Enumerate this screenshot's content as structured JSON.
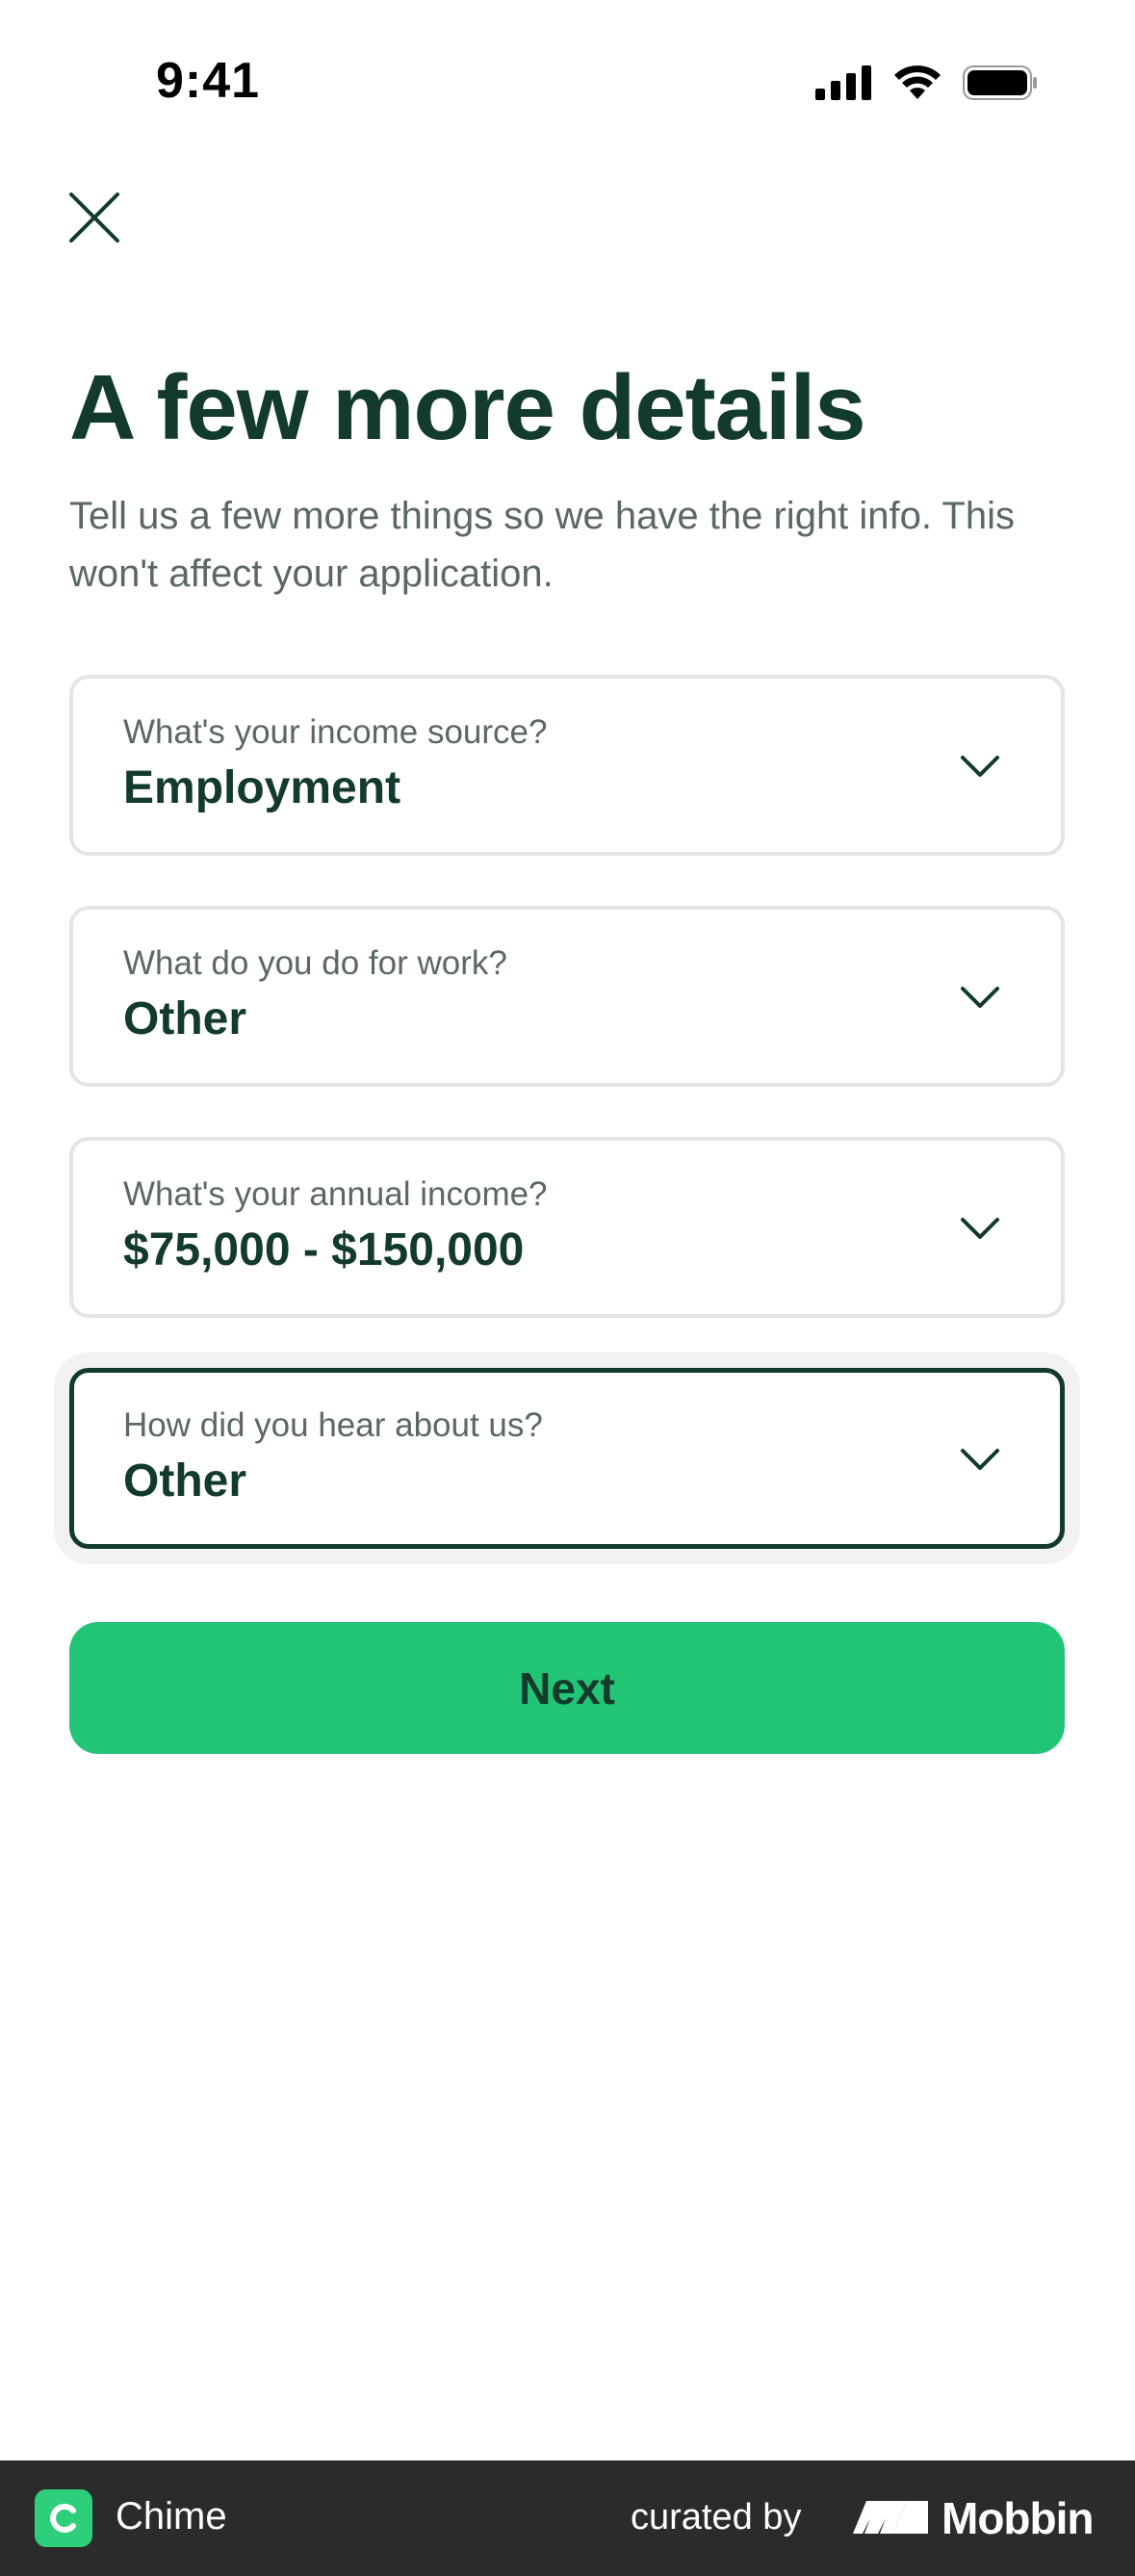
{
  "status_bar": {
    "time": "9:41",
    "icons": [
      "cellular-signal-icon",
      "wifi-icon",
      "battery-icon"
    ]
  },
  "header": {
    "close_icon": "close-icon"
  },
  "page": {
    "title": "A few more details",
    "subtitle": "Tell us a few more things so we have the right info. This won't affect your application."
  },
  "fields": [
    {
      "label": "What's your income source?",
      "value": "Employment",
      "focused": false
    },
    {
      "label": "What do you do for work?",
      "value": "Other",
      "focused": false
    },
    {
      "label": "What's your annual income?",
      "value": "$75,000 - $150,000",
      "focused": false
    },
    {
      "label": "How did you hear about us?",
      "value": "Other",
      "focused": true
    }
  ],
  "actions": {
    "next_label": "Next"
  },
  "footer": {
    "app_name": "Chime",
    "curated_by": "curated by",
    "brand": "Mobbin"
  },
  "colors": {
    "primary_text": "#123a2d",
    "secondary_text": "#5b6865",
    "accent": "#22c575",
    "border": "#e2e5e4",
    "footer_bg": "#2b2b2b"
  }
}
